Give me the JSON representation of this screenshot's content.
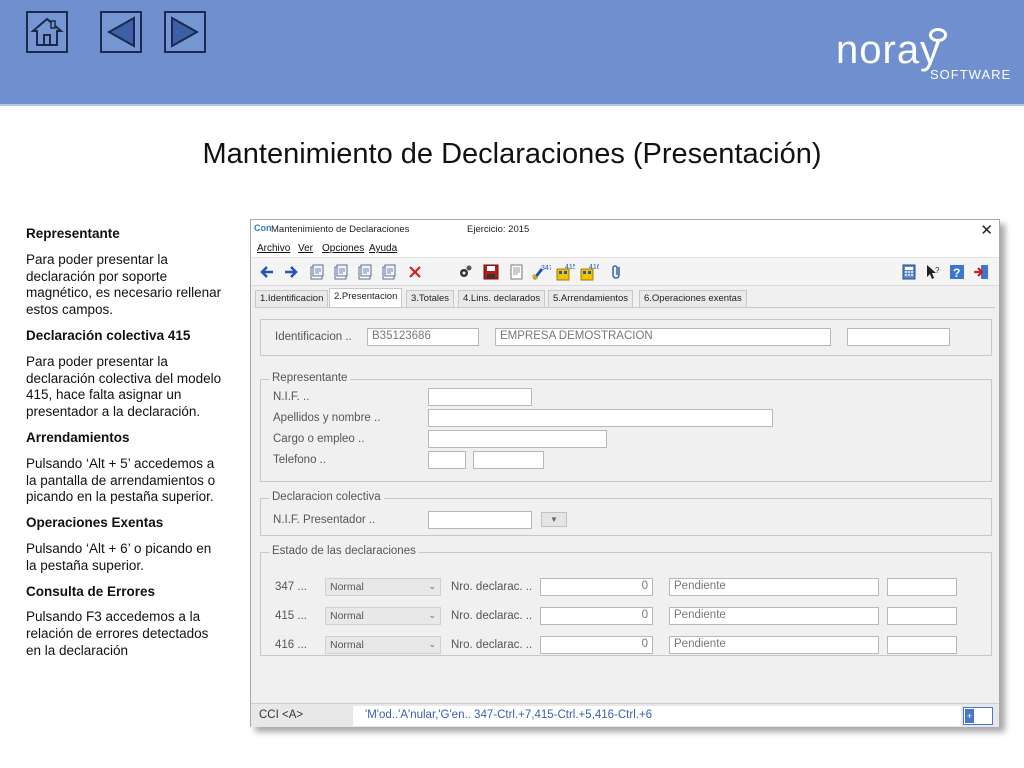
{
  "banner": {
    "nav": [
      {
        "name": "home-icon"
      },
      {
        "name": "previous-icon"
      },
      {
        "name": "next-icon"
      }
    ],
    "logo_text": "noray",
    "logo_sub": "SOFTWARE",
    "colors": {
      "banner": "#6f8fcf",
      "nav_border": "#1b2a4a"
    }
  },
  "page_title": "Mantenimiento de Declaraciones (Presentación)",
  "notes": [
    {
      "heading": "Representante",
      "text": "Para poder presentar la declaración por soporte magnético, es necesario rellenar estos campos."
    },
    {
      "heading": "Declaración colectiva  415",
      "text": "Para poder presentar la declaración colectiva del modelo 415, hace falta asignar un presentador a la declaración."
    },
    {
      "heading": "Arrendamientos",
      "text": "Pulsando ‘Alt + 5’ accedemos a la pantalla de arrendamientos o picando en la pestaña superior."
    },
    {
      "heading": "Operaciones Exentas",
      "text": "Pulsando ‘Alt + 6’ o picando en la pestaña superior."
    },
    {
      "heading": "Consulta de Errores",
      "text": "Pulsando F3 accedemos a la relación de errores detectados en la declaración"
    }
  ],
  "window": {
    "app_icon": "Con",
    "title": "Mantenimiento de Declaraciones",
    "ejercicio": "Ejercicio: 2015",
    "close": "✕",
    "menu": [
      "Archivo",
      "Ver",
      "Opciones",
      "Ayuda"
    ],
    "toolbar_icons": [
      "back-arrow-icon",
      "forward-arrow-icon",
      "new-doc-icon",
      "copy-doc-icon",
      "edit-doc-icon",
      "doc-icon",
      "delete-icon",
      "settings-icon",
      "save-icon",
      "print-preview-icon",
      "model-347-icon",
      "model-415-icon",
      "model-416-icon",
      "attach-icon",
      "calculator-icon",
      "help-pointer-icon",
      "help-icon",
      "exit-icon"
    ],
    "tabs": [
      "1.Identificacion",
      "2.Presentacion",
      "3.Totales",
      "4.Lins. declarados",
      "5.Arrendamientos",
      "6.Operaciones exentas"
    ],
    "active_tab": 1,
    "identificacion": {
      "label": "Identificacion ..",
      "nif": "B35123686",
      "empresa": "EMPRESA DEMOSTRACION",
      "extra": ""
    },
    "representante": {
      "title": "Representante",
      "fields": [
        {
          "label": "N.I.F. ..",
          "value": ""
        },
        {
          "label": "Apellidos y nombre ..",
          "value": ""
        },
        {
          "label": "Cargo o empleo ..",
          "value": ""
        },
        {
          "label": "Telefono ..",
          "value": "",
          "value2": ""
        }
      ]
    },
    "colectiva": {
      "title": "Declaracion colectiva",
      "label": "N.I.F. Presentador ..",
      "value": "",
      "button": "▼"
    },
    "estado": {
      "title": "Estado de las declaraciones",
      "rows": [
        {
          "model": "347 ...",
          "type": "Normal",
          "nro_label": "Nro. declarac. ..",
          "nro": "0",
          "status": "Pendiente",
          "extra": ""
        },
        {
          "model": "415 ...",
          "type": "Normal",
          "nro_label": "Nro. declarac. ..",
          "nro": "0",
          "status": "Pendiente",
          "extra": ""
        },
        {
          "model": "416 ...",
          "type": "Normal",
          "nro_label": "Nro. declarac. ..",
          "nro": "0",
          "status": "Pendiente",
          "extra": ""
        }
      ]
    },
    "status": {
      "left": "CCI <A>",
      "hint": "'M'od..'A'nular,'G'en.. 347-Ctrl.+7,415-Ctrl.+5,416-Ctrl.+6",
      "indicator": "+"
    }
  }
}
